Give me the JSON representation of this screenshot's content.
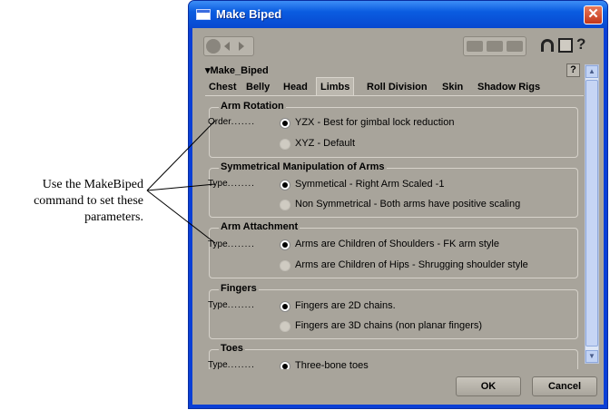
{
  "callout": {
    "lines": [
      "Use the MakeBiped",
      "command to set these",
      "parameters."
    ]
  },
  "window": {
    "title": "Make Biped",
    "close_glyph": "✕"
  },
  "toolbar": {
    "left_icons": [
      "wrench-icon",
      "arrow-left-icon",
      "arrow-right-icon"
    ],
    "right_icons": [
      "paste-icon",
      "paste-left-icon",
      "paste-right-icon",
      "magnet-icon",
      "copy-icon",
      "help-icon"
    ],
    "help_glyph": "?"
  },
  "rollout": {
    "title": "▾Make_Biped",
    "help_glyph": "?"
  },
  "tabs": [
    {
      "label": "Chest",
      "active": false
    },
    {
      "label": "Belly",
      "active": false
    },
    {
      "label": "Head",
      "active": false
    },
    {
      "label": "Limbs",
      "active": true
    },
    {
      "label": "Roll Division",
      "active": false
    },
    {
      "label": "Skin",
      "active": false
    },
    {
      "label": "Shadow Rigs",
      "active": false
    }
  ],
  "groups": [
    {
      "title": "Arm Rotation",
      "label": "Order",
      "options": [
        {
          "text": "YZX - Best for gimbal lock reduction",
          "selected": true
        },
        {
          "text": "XYZ - Default",
          "selected": false
        }
      ]
    },
    {
      "title": "Symmetrical Manipulation of Arms",
      "label": "Type",
      "options": [
        {
          "text": "Symmetical - Right Arm Scaled -1",
          "selected": true
        },
        {
          "text": "Non Symmetrical - Both arms have positive scaling",
          "selected": false
        }
      ]
    },
    {
      "title": "Arm Attachment",
      "label": "Type",
      "options": [
        {
          "text": "Arms are Children of Shoulders - FK arm style",
          "selected": true
        },
        {
          "text": "Arms are Children of Hips - Shrugging shoulder style",
          "selected": false
        }
      ]
    },
    {
      "title": "Fingers",
      "label": "Type",
      "options": [
        {
          "text": "Fingers are 2D chains.",
          "selected": true
        },
        {
          "text": "Fingers are 3D chains (non planar fingers)",
          "selected": false
        }
      ]
    },
    {
      "title": "Toes",
      "label": "Type",
      "options": [
        {
          "text": "Three-bone toes",
          "selected": true
        }
      ]
    }
  ],
  "buttons": {
    "ok": "OK",
    "cancel": "Cancel"
  }
}
